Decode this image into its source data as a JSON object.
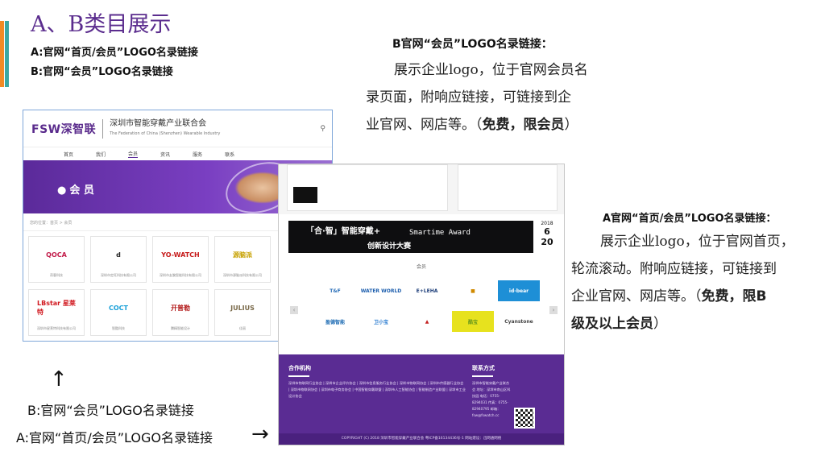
{
  "slide": {
    "title": "A、B类目展示",
    "sub_a": "A:官网“首页/会员”LOGO名录链接",
    "sub_b": "B:官网“会员”LOGO名录链接",
    "section_b": {
      "header": "B官网“会员”LOGO名录链接：",
      "line1": "展示企业logo，位于官网会员名",
      "line2": "录页面，附响应链接，可链接到企",
      "line3_plain": "业官网、网店等。（",
      "line3_bold": "免费，限会员",
      "line3_end": "）"
    },
    "section_a": {
      "header": "A官网“首页/会员”LOGO名录链接：",
      "line1": "展示企业logo，位于官网首页，",
      "line2": "轮流滚动。附响应链接，可链接到",
      "line3_plain": "企业官网、网店等。（",
      "line3_bold": "免费，限B",
      "line4_bold": "级及以上会员",
      "line4_end": "）"
    },
    "caption_b": "B:官网“会员”LOGO名录链接",
    "caption_a": "A:官网“首页/会员”LOGO名录链接",
    "arrow_up": "↑",
    "arrow_right": "→"
  },
  "shot_member": {
    "logo": "FSW深智联",
    "org_name": "深圳市智能穿戴产业联合会",
    "org_en": "The Federation of China (Shenzhen) Wearable Industry",
    "nav": [
      "首页",
      "我们",
      "会员",
      "资讯",
      "服务",
      "联系"
    ],
    "banner_title": "会 员",
    "breadcrumb": "您的位置：首页 > 会员",
    "members": [
      {
        "logo": "QOCA",
        "name": "奇客科技",
        "color": "#c21c4a"
      },
      {
        "logo": "d",
        "name": "深圳市定旺科技有限公司",
        "color": "#222"
      },
      {
        "logo": "YO-WATCH",
        "name": "深圳市友腕智能科技有限公司",
        "color": "#c61a1a"
      },
      {
        "logo": "源脑派",
        "name": "深圳市源脑派科技有限公司",
        "color": "#c7a100"
      },
      {
        "logo": "LBstar 星莱特",
        "name": "深圳市星莱特科技有限公司",
        "color": "#d1181f"
      },
      {
        "logo": "COCT",
        "name": "智酷科技",
        "color": "#1aa0d8"
      },
      {
        "logo": "开普勒",
        "name": "腾精智能设计",
        "color": "#b31b1b"
      },
      {
        "logo": "JULIUS",
        "name": "佳丽",
        "color": "#7a6a4a"
      }
    ]
  },
  "shot_home": {
    "banner_left": "「合·智」智能穿戴+",
    "banner_right": "Smartime Award",
    "banner_sub": "创新设计大赛",
    "date_year": "2018",
    "date_day": "20",
    "date_month": "6",
    "members_label": "会员",
    "logos": [
      {
        "text": "T&F",
        "color": "#2a6fb8"
      },
      {
        "text": "WATER WORLD",
        "color": "#1e5fae"
      },
      {
        "text": "E+LEHA",
        "color": "#1e3f7a"
      },
      {
        "text": "■",
        "color": "#d08a00"
      },
      {
        "text": "id-bear",
        "color": "#ffffff",
        "bg": "#1e8fd6"
      },
      {
        "text": "盈德智能",
        "color": "#1b6ab3"
      },
      {
        "text": "卫小宝",
        "color": "#2a7bd0"
      },
      {
        "text": "▲",
        "color": "#c32020"
      },
      {
        "text": "酷宝",
        "color": "#6a9a1c",
        "bg": "#e7e21e"
      },
      {
        "text": "Cyanstone",
        "color": "#444"
      }
    ],
    "footer_left_title": "合作机构",
    "footer_left_text": "深圳市物联网行业协会 | 深圳市企业评价协会 | 深圳市信息服务行业协会 | 深圳市物联网协会 | 深圳市传感器行业协会 | 深圳市物联网协会 | 深圳市电子商务协会 | 中国智能穿戴联盟 | 深圳市人工智能协会 | 智能制造产业联盟 | 深圳市工业设计协会",
    "footer_right_title": "联系方式",
    "footer_right_text": "深圳市智能穿戴产业联合会 地址：深圳市南山区科技园 电话：0755-8294031 传真：0755-82940795 邮箱：fsw@fswatch.cc",
    "copyright": "COPYRIGHT (C) 2018 深圳市智能穿戴产业联合会 粤ICP备16134436号-1 网站建设：迅网通网络"
  }
}
